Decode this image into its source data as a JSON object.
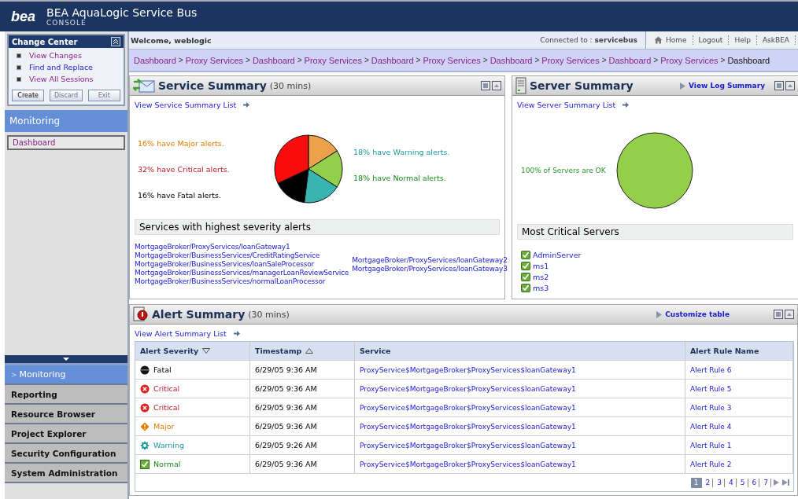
{
  "header": {
    "product": "BEA AquaLogic Service Bus",
    "subtitle": "CONSOLE",
    "logo": "bea"
  },
  "change_center": {
    "title": "Change Center",
    "links": [
      {
        "label": "View Changes",
        "visited": true
      },
      {
        "label": "Find and Replace",
        "visited": false
      },
      {
        "label": "View All Sessions",
        "visited": true
      }
    ],
    "buttons": [
      {
        "label": "Create",
        "disabled": false
      },
      {
        "label": "Discard",
        "disabled": true
      },
      {
        "label": "Exit",
        "disabled": true
      }
    ]
  },
  "sidebar": {
    "section": "Monitoring",
    "items": [
      {
        "label": "Dashboard",
        "selected": true
      }
    ]
  },
  "nav": {
    "marker": ">",
    "items": [
      {
        "label": "Monitoring",
        "selected": true
      },
      {
        "label": "Reporting",
        "selected": false
      },
      {
        "label": "Resource Browser",
        "selected": false
      },
      {
        "label": "Project Explorer",
        "selected": false
      },
      {
        "label": "Security Configuration",
        "selected": false
      },
      {
        "label": "System Administration",
        "selected": false
      }
    ]
  },
  "top_bar": {
    "welcome": "Welcome, weblogic",
    "connection": "Connected to : **servicebus**",
    "links": [
      "Home",
      "Logout",
      "Help",
      "AskBEA"
    ]
  },
  "breadcrumb": [
    "Dashboard",
    "Proxy Services",
    "Dashboard",
    "Proxy Services",
    "Dashboard",
    "Proxy Services",
    "Dashboard",
    "Proxy Services",
    "Dashboard",
    "Proxy Services",
    "Dashboard"
  ],
  "breadcrumb_separator": ">",
  "service_summary": {
    "title": "Service Summary",
    "period": "(30 mins)",
    "list_link": "View Service Summary List",
    "legend_left": [
      {
        "kind": "major",
        "text": "16% have Major alerts."
      },
      {
        "kind": "critical",
        "text": "32% have Critical alerts."
      },
      {
        "kind": "fatal",
        "text": "16% have Fatal alerts."
      }
    ],
    "legend_right": [
      {
        "kind": "warning",
        "text": "18% have Warning alerts."
      },
      {
        "kind": "normal",
        "text": "18% have Normal alerts."
      }
    ],
    "services_heading": "Services with highest severity alerts",
    "services_col1": [
      "MortgageBroker/ProxyServices/loanGateway1",
      "MortgageBroker/BusinessServices/CreditRatingService",
      "MortgageBroker/BusinessServices/loanSaleProcessor",
      "MortgageBroker/BusinessServices/managerLoanReviewService",
      "MortgageBroker/BusinessServices/normalLoanProcessor"
    ],
    "services_col2": [
      "MortgageBroker/ProxyServices/loanGateway2",
      "MortgageBroker/ProxyServices/loanGateway3"
    ]
  },
  "server_summary": {
    "title": "Server Summary",
    "action": "View Log Summary",
    "list_link": "View Server Summary List",
    "status": "100% of Servers are OK",
    "critical_heading": "Most Critical Servers",
    "servers": [
      {
        "name": "AdminServer",
        "ok": true
      },
      {
        "name": "ms1",
        "ok": true
      },
      {
        "name": "ms2",
        "ok": true
      },
      {
        "name": "ms3",
        "ok": true
      }
    ]
  },
  "alert_summary": {
    "title": "Alert Summary",
    "period": "(30 mins)",
    "action": "Customize table",
    "list_link": "View Alert Summary List",
    "columns": [
      {
        "label": "Alert Severity",
        "kind": "descending"
      },
      {
        "label": "Timestamp",
        "kind": "ascending"
      },
      {
        "label": "Service",
        "kind": "plain"
      },
      {
        "label": "Alert Rule Name",
        "kind": "plain"
      }
    ],
    "rows": [
      {
        "kind": "fatal",
        "severity": "Fatal",
        "timestamp": "6/29/05 9:36 AM",
        "service": "ProxyService$MortgageBroker$ProxyServices$loanGateway1",
        "rule": "Alert Rule 6"
      },
      {
        "kind": "critical",
        "severity": "Critical",
        "timestamp": "6/29/05 9:36 AM",
        "service": "ProxyService$MortgageBroker$ProxyServices$loanGateway1",
        "rule": "Alert Rule 5"
      },
      {
        "kind": "critical",
        "severity": "Critical",
        "timestamp": "6/29/05 9:36 AM",
        "service": "ProxyService$MortgageBroker$ProxyServices$loanGateway1",
        "rule": "Alert Rule 3"
      },
      {
        "kind": "major",
        "severity": "Major",
        "timestamp": "6/29/05 9:36 AM",
        "service": "ProxyService$MortgageBroker$ProxyServices$loanGateway1",
        "rule": "Alert Rule 4"
      },
      {
        "kind": "warning",
        "severity": "Warning",
        "timestamp": "6/29/05 9:26 AM",
        "service": "ProxyService$MortgageBroker$ProxyServices$loanGateway1",
        "rule": "Alert Rule 1"
      },
      {
        "kind": "normal",
        "severity": "Normal",
        "timestamp": "6/29/05 9:36 AM",
        "service": "ProxyService$MortgageBroker$ProxyServices$loanGateway1",
        "rule": "Alert Rule 2"
      }
    ],
    "pages": [
      {
        "label": "1",
        "selected": true
      },
      {
        "label": "2",
        "selected": false
      },
      {
        "label": "3",
        "selected": false
      },
      {
        "label": "4",
        "selected": false
      },
      {
        "label": "5",
        "selected": false
      },
      {
        "label": "6",
        "selected": false
      },
      {
        "label": "7",
        "selected": false
      }
    ]
  }
}
